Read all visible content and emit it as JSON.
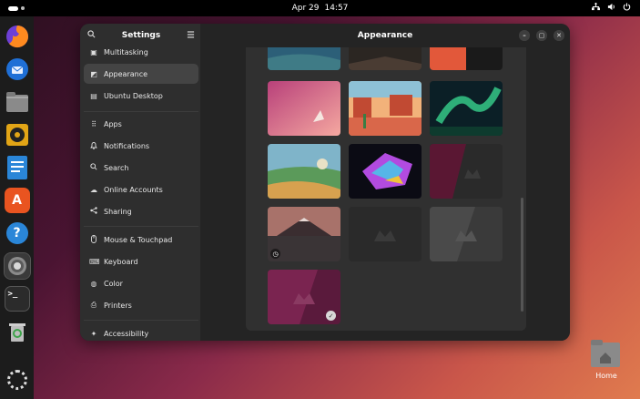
{
  "topbar": {
    "date": "Apr 29",
    "time": "14:57"
  },
  "dock": {
    "apps": [
      {
        "name": "Firefox",
        "icon": "firefox-icon"
      },
      {
        "name": "Thunderbird",
        "icon": "thunderbird-icon"
      },
      {
        "name": "Files",
        "icon": "files-icon"
      },
      {
        "name": "Rhythmbox",
        "icon": "rhythmbox-icon"
      },
      {
        "name": "LibreOffice Writer",
        "icon": "writer-icon"
      },
      {
        "name": "App Center",
        "icon": "app-center-icon"
      },
      {
        "name": "Help",
        "icon": "help-icon"
      },
      {
        "name": "Settings",
        "icon": "settings-gear-icon"
      },
      {
        "name": "Terminal",
        "icon": "terminal-icon"
      },
      {
        "name": "Trash",
        "icon": "trash-icon"
      }
    ],
    "help_glyph": "?",
    "app_center_glyph": "A",
    "terminal_glyph": ">_"
  },
  "settings": {
    "sidebar_title": "Settings",
    "page_title": "Appearance",
    "sidebar_items": [
      {
        "label": "Multitasking",
        "icon": "multitasking-icon"
      },
      {
        "label": "Appearance",
        "icon": "appearance-icon",
        "selected": true
      },
      {
        "label": "Ubuntu Desktop",
        "icon": "ubuntu-desktop-icon"
      },
      {
        "label": "Apps",
        "icon": "apps-icon"
      },
      {
        "label": "Notifications",
        "icon": "bell-icon"
      },
      {
        "label": "Search",
        "icon": "search-icon"
      },
      {
        "label": "Online Accounts",
        "icon": "cloud-icon"
      },
      {
        "label": "Sharing",
        "icon": "share-icon"
      },
      {
        "label": "Mouse & Touchpad",
        "icon": "mouse-icon"
      },
      {
        "label": "Keyboard",
        "icon": "keyboard-icon"
      },
      {
        "label": "Color",
        "icon": "color-icon"
      },
      {
        "label": "Printers",
        "icon": "printer-icon"
      },
      {
        "label": "Accessibility",
        "icon": "accessibility-icon"
      }
    ]
  },
  "wallpapers": [
    {
      "name": "wallpaper-ocean-dusk",
      "colors": [
        "#2c5f78",
        "#3f7b86"
      ]
    },
    {
      "name": "wallpaper-dark-mountain",
      "colors": [
        "#2b2622",
        "#4a3c33"
      ]
    },
    {
      "name": "wallpaper-orange-black",
      "colors": [
        "#e2583a",
        "#1a1a1a"
      ]
    },
    {
      "name": "wallpaper-pink-gradient",
      "colors": [
        "#d15c8e",
        "#f5a8a0"
      ]
    },
    {
      "name": "wallpaper-desert-mesa",
      "colors": [
        "#d9674a",
        "#f2b27a"
      ]
    },
    {
      "name": "wallpaper-aurora",
      "colors": [
        "#0e3b2e",
        "#37d28d"
      ]
    },
    {
      "name": "wallpaper-painted-landscape",
      "colors": [
        "#7fb4c9",
        "#d7a14f"
      ]
    },
    {
      "name": "wallpaper-neon-crystal",
      "colors": [
        "#0b0b14",
        "#b24be0"
      ]
    },
    {
      "name": "wallpaper-maroon-mascot",
      "colors": [
        "#5a1733",
        "#2a2a2a"
      ]
    },
    {
      "name": "wallpaper-fuji-sunset",
      "colors": [
        "#a8726a",
        "#3a3436"
      ]
    },
    {
      "name": "wallpaper-dark-mascot",
      "colors": [
        "#2a2a2a",
        "#343434"
      ]
    },
    {
      "name": "wallpaper-gray-mascot",
      "colors": [
        "#4a4a4a",
        "#3a3a3a"
      ]
    },
    {
      "name": "wallpaper-purple-mascot",
      "colors": [
        "#7a2450",
        "#5a1a3c"
      ],
      "selected": true
    }
  ],
  "desktop": {
    "home_label": "Home"
  },
  "colors": {
    "accent": "#e95420",
    "window_bg": "#242424",
    "sidebar_bg": "#2e2e2e"
  }
}
